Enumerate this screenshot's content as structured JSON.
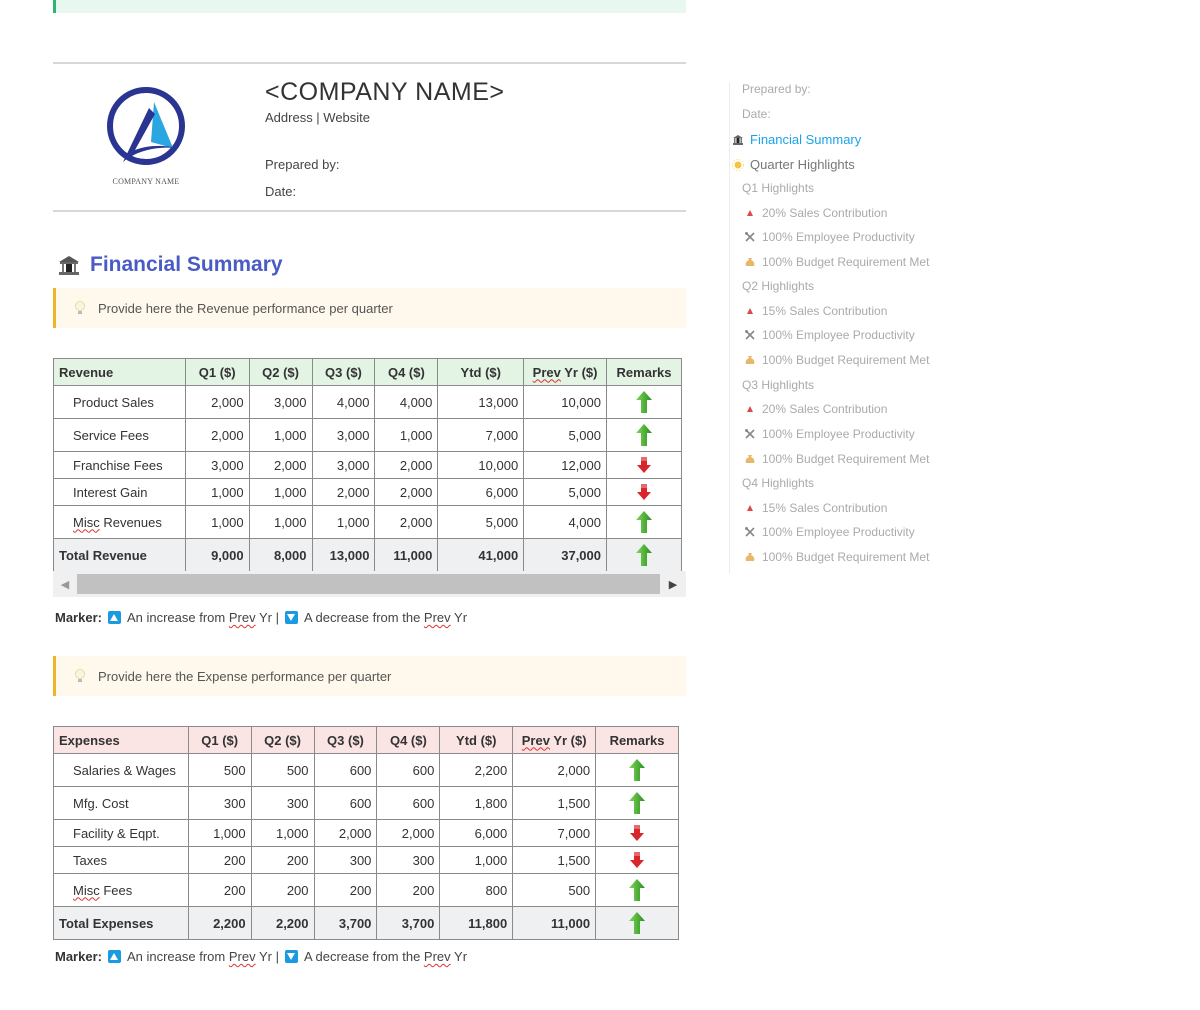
{
  "header": {
    "company_name": "<COMPANY NAME>",
    "address_line": "Address | Website",
    "prepared_by_label": "Prepared by:",
    "date_label": "Date:",
    "logo_text": "COMPANY NAME"
  },
  "section": {
    "title": "Financial Summary",
    "icon": "bank-icon"
  },
  "revenue_hint": "Provide here the Revenue performance per quarter",
  "expense_hint": "Provide here the Expense performance per quarter",
  "revenue_table": {
    "headers": [
      "Revenue",
      "Q1 ($)",
      "Q2 ($)",
      "Q3 ($)",
      "Q4 ($)",
      "Ytd ($)",
      "Prev Yr ($)",
      "Remarks"
    ],
    "prev_word": "Prev",
    "prev_rest": " Yr ($)",
    "rows": [
      {
        "label": "Product Sales",
        "q1": "2,000",
        "q2": "3,000",
        "q3": "4,000",
        "q4": "4,000",
        "ytd": "13,000",
        "prev": "10,000",
        "remark": "up"
      },
      {
        "label": "Service Fees",
        "q1": "2,000",
        "q2": "1,000",
        "q3": "3,000",
        "q4": "1,000",
        "ytd": "7,000",
        "prev": "5,000",
        "remark": "up"
      },
      {
        "label": "Franchise Fees",
        "q1": "3,000",
        "q2": "2,000",
        "q3": "3,000",
        "q4": "2,000",
        "ytd": "10,000",
        "prev": "12,000",
        "remark": "down"
      },
      {
        "label": "Interest Gain",
        "q1": "1,000",
        "q2": "1,000",
        "q3": "2,000",
        "q4": "2,000",
        "ytd": "6,000",
        "prev": "5,000",
        "remark": "down"
      },
      {
        "label": "Misc Revenues",
        "label_a": "Misc",
        "label_b": " Revenues",
        "q1": "1,000",
        "q2": "1,000",
        "q3": "1,000",
        "q4": "2,000",
        "ytd": "5,000",
        "prev": "4,000",
        "remark": "up"
      }
    ],
    "total": {
      "label": "Total Revenue",
      "q1": "9,000",
      "q2": "8,000",
      "q3": "13,000",
      "q4": "11,000",
      "ytd": "41,000",
      "prev": "37,000",
      "remark": "up"
    }
  },
  "expense_table": {
    "headers": [
      "Expenses",
      "Q1 ($)",
      "Q2 ($)",
      "Q3 ($)",
      "Q4 ($)",
      "Ytd ($)",
      "Prev Yr ($)",
      "Remarks"
    ],
    "prev_word": "Prev",
    "prev_rest": " Yr ($)",
    "rows": [
      {
        "label": "Salaries & Wages",
        "q1": "500",
        "q2": "500",
        "q3": "600",
        "q4": "600",
        "ytd": "2,200",
        "prev": "2,000",
        "remark": "up"
      },
      {
        "label": "Mfg. Cost",
        "q1": "300",
        "q2": "300",
        "q3": "600",
        "q4": "600",
        "ytd": "1,800",
        "prev": "1,500",
        "remark": "up"
      },
      {
        "label": "Facility & Eqpt.",
        "q1": "1,000",
        "q2": "1,000",
        "q3": "2,000",
        "q4": "2,000",
        "ytd": "6,000",
        "prev": "7,000",
        "remark": "down"
      },
      {
        "label": "Taxes",
        "q1": "200",
        "q2": "200",
        "q3": "300",
        "q4": "300",
        "ytd": "1,000",
        "prev": "1,500",
        "remark": "down"
      },
      {
        "label": "Misc Fees",
        "label_a": "Misc",
        "label_b": " Fees",
        "q1": "200",
        "q2": "200",
        "q3": "200",
        "q4": "200",
        "ytd": "800",
        "prev": "500",
        "remark": "up"
      }
    ],
    "total": {
      "label": "Total Expenses",
      "q1": "2,200",
      "q2": "2,200",
      "q3": "3,700",
      "q4": "3,700",
      "ytd": "11,800",
      "prev": "11,000",
      "remark": "up"
    }
  },
  "marker": {
    "label": "Marker:",
    "increase_a": "An increase from ",
    "prev": "Prev",
    "increase_b": " Yr |",
    "decrease_a": "A decrease from the ",
    "decrease_b": " Yr"
  },
  "toc": {
    "items": [
      {
        "label": "Prepared by:",
        "level": 1,
        "icon": ""
      },
      {
        "label": "Date:",
        "level": 1,
        "icon": ""
      },
      {
        "label": "Financial Summary",
        "level": 0,
        "icon": "bank-icon",
        "active": true
      },
      {
        "label": "Quarter Highlights",
        "level": 0,
        "icon": "sun-icon"
      },
      {
        "label": "Q1 Highlights",
        "level": 1,
        "icon": ""
      },
      {
        "label": "20% Sales Contribution",
        "level": 2,
        "icon": "triangle-up-icon"
      },
      {
        "label": "100% Employee Productivity",
        "level": 2,
        "icon": "tools-icon"
      },
      {
        "label": "100% Budget Requirement Met",
        "level": 2,
        "icon": "money-bag-icon"
      },
      {
        "label": "Q2 Highlights",
        "level": 1,
        "icon": ""
      },
      {
        "label": "15% Sales Contribution",
        "level": 2,
        "icon": "triangle-up-icon"
      },
      {
        "label": "100% Employee Productivity",
        "level": 2,
        "icon": "tools-icon"
      },
      {
        "label": "100% Budget Requirement Met",
        "level": 2,
        "icon": "money-bag-icon"
      },
      {
        "label": "Q3 Highlights",
        "level": 1,
        "icon": ""
      },
      {
        "label": "20% Sales Contribution",
        "level": 2,
        "icon": "triangle-up-icon"
      },
      {
        "label": "100% Employee Productivity",
        "level": 2,
        "icon": "tools-icon"
      },
      {
        "label": "100% Budget Requirement Met",
        "level": 2,
        "icon": "money-bag-icon"
      },
      {
        "label": "Q4 Highlights",
        "level": 1,
        "icon": ""
      },
      {
        "label": "15% Sales Contribution",
        "level": 2,
        "icon": "triangle-up-icon"
      },
      {
        "label": "100% Employee Productivity",
        "level": 2,
        "icon": "tools-icon"
      },
      {
        "label": "100% Budget Requirement Met",
        "level": 2,
        "icon": "money-bag-icon"
      }
    ]
  },
  "colors": {
    "accent_blue": "#4a5bc4",
    "toc_active": "#1aa3e8",
    "up_arrow": "#2e9e2e",
    "down_arrow": "#d9262b",
    "revenue_header_bg": "#e3f3e4",
    "expense_header_bg": "#fbe4e4",
    "hint_border": "#f0b429"
  }
}
